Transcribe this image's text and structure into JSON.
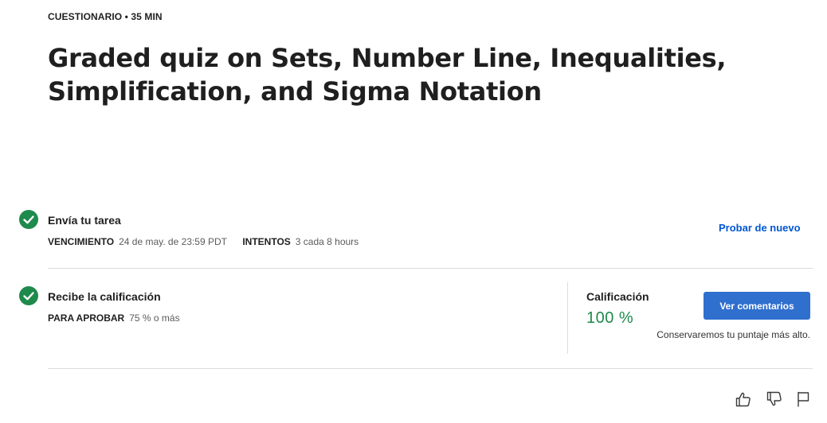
{
  "header": {
    "eyebrow": "CUESTIONARIO • 35 MIN",
    "title": "Graded quiz on Sets, Number Line, Inequalities, Simplification, and Sigma Notation"
  },
  "submit_section": {
    "title": "Envía tu tarea",
    "due_label": "VENCIMIENTO",
    "due_value": "24 de may. de 23:59 PDT",
    "attempts_label": "INTENTOS",
    "attempts_value": "3 cada 8 hours",
    "retry_label": "Probar de nuevo"
  },
  "grade_section": {
    "title": "Recibe la calificación",
    "pass_label": "PARA APROBAR",
    "pass_value": "75 % o más",
    "grade_label": "Calificación",
    "grade_value": "100 %",
    "feedback_button": "Ver comentarios",
    "note": "Conservaremos tu puntaje más alto."
  },
  "footer": {
    "icons": [
      "thumbs-up-icon",
      "thumbs-down-icon",
      "flag-icon"
    ]
  },
  "colors": {
    "success": "#1e8a4c",
    "link": "#0056d2",
    "primary_button": "#2f6fce"
  }
}
